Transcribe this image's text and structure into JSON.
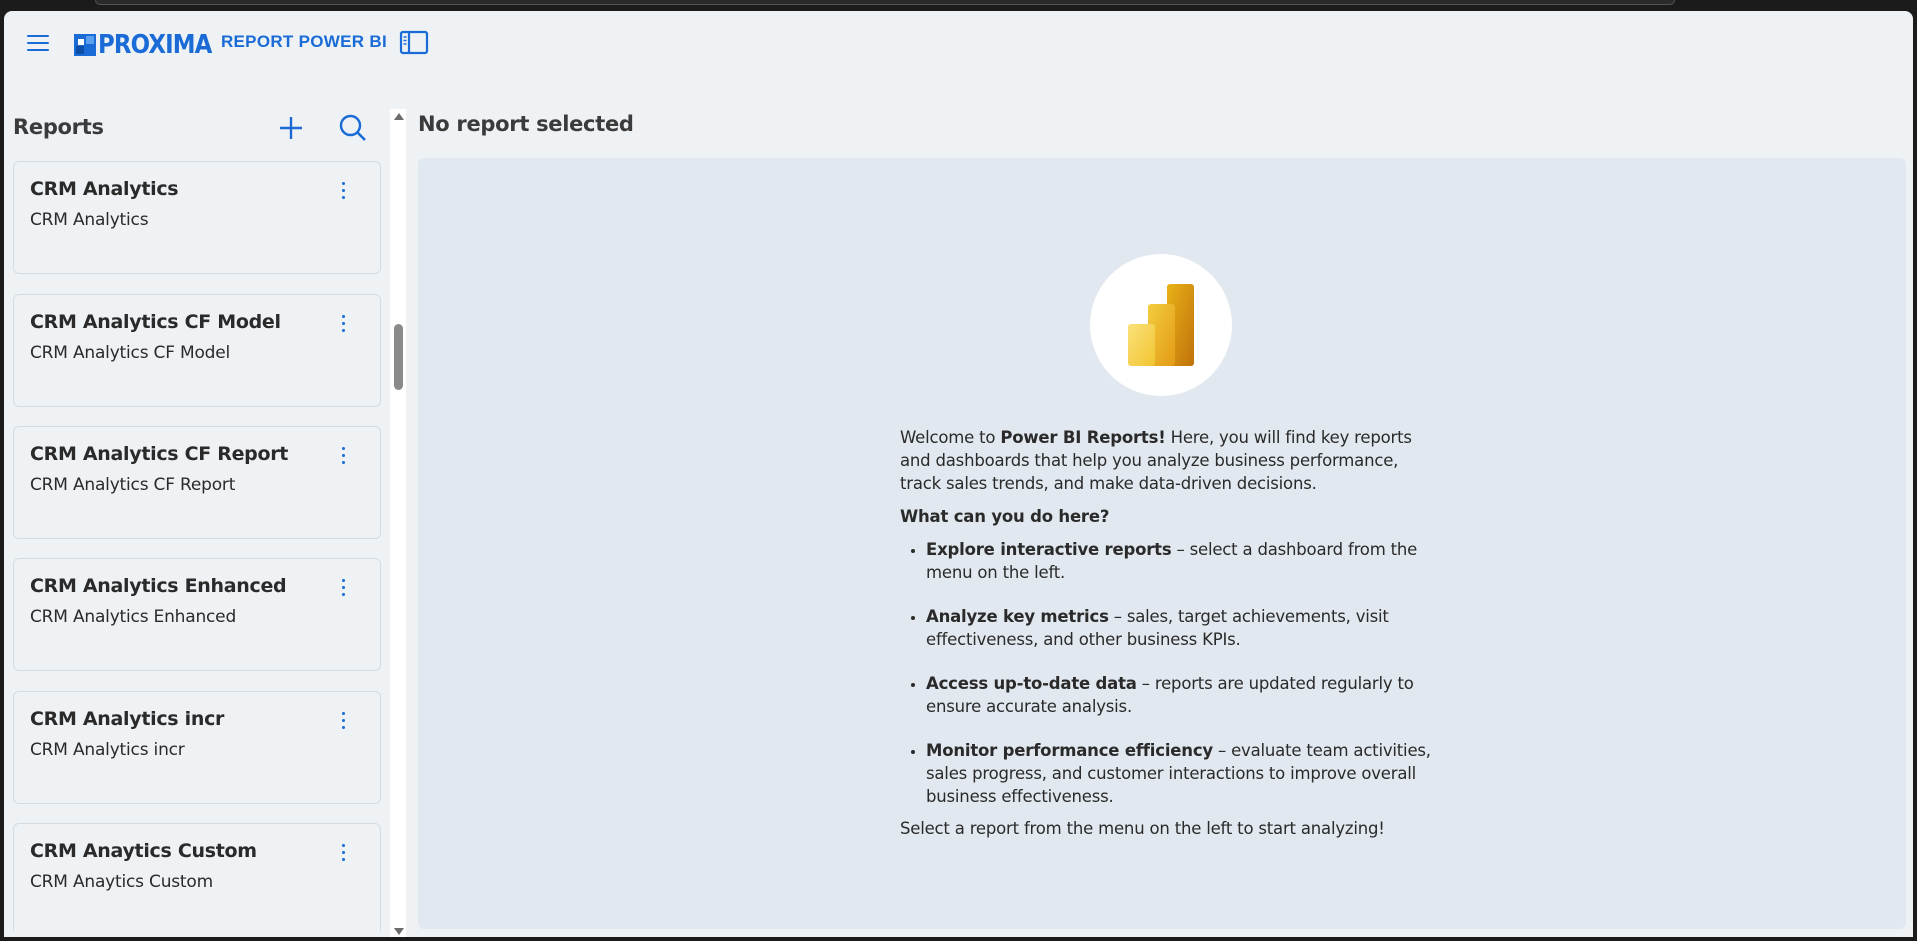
{
  "header": {
    "logo_text": "PROXIMA",
    "logo_subtitle": "REPORT POWER BI",
    "accent_color": "#1a6bd6"
  },
  "sidebar": {
    "title": "Reports",
    "add_icon": "plus-icon",
    "search_icon": "search-icon",
    "reports": [
      {
        "title": "CRM Analytics",
        "subtitle": "CRM Analytics"
      },
      {
        "title": "CRM Analytics CF Model",
        "subtitle": "CRM Analytics CF Model"
      },
      {
        "title": "CRM Analytics CF Report",
        "subtitle": "CRM Analytics CF Report"
      },
      {
        "title": "CRM Analytics Enhanced",
        "subtitle": "CRM Analytics Enhanced"
      },
      {
        "title": "CRM Analytics incr",
        "subtitle": "CRM Analytics incr"
      },
      {
        "title": "CRM Anaytics Custom",
        "subtitle": "CRM Anaytics Custom"
      }
    ]
  },
  "main": {
    "title": "No report selected",
    "welcome": {
      "intro_prefix": "Welcome to ",
      "intro_bold": "Power BI Reports!",
      "intro_rest": " Here, you will find key reports and dashboards that help you analyze business performance, track sales trends, and make data-driven decisions.",
      "question": "What can you do here?",
      "items": [
        {
          "bold": "Explore interactive reports",
          "text": " – select a dashboard from the menu on the left."
        },
        {
          "bold": "Analyze key metrics",
          "text": " – sales, target achievements, visit effectiveness, and other business KPIs."
        },
        {
          "bold": "Access up-to-date data",
          "text": " – reports are updated regularly to ensure accurate analysis."
        },
        {
          "bold": "Monitor performance efficiency",
          "text": " – evaluate team activities, sales progress, and customer interactions to improve overall business effectiveness."
        }
      ],
      "closing": "Select a report from the menu on the left to start analyzing!"
    }
  }
}
